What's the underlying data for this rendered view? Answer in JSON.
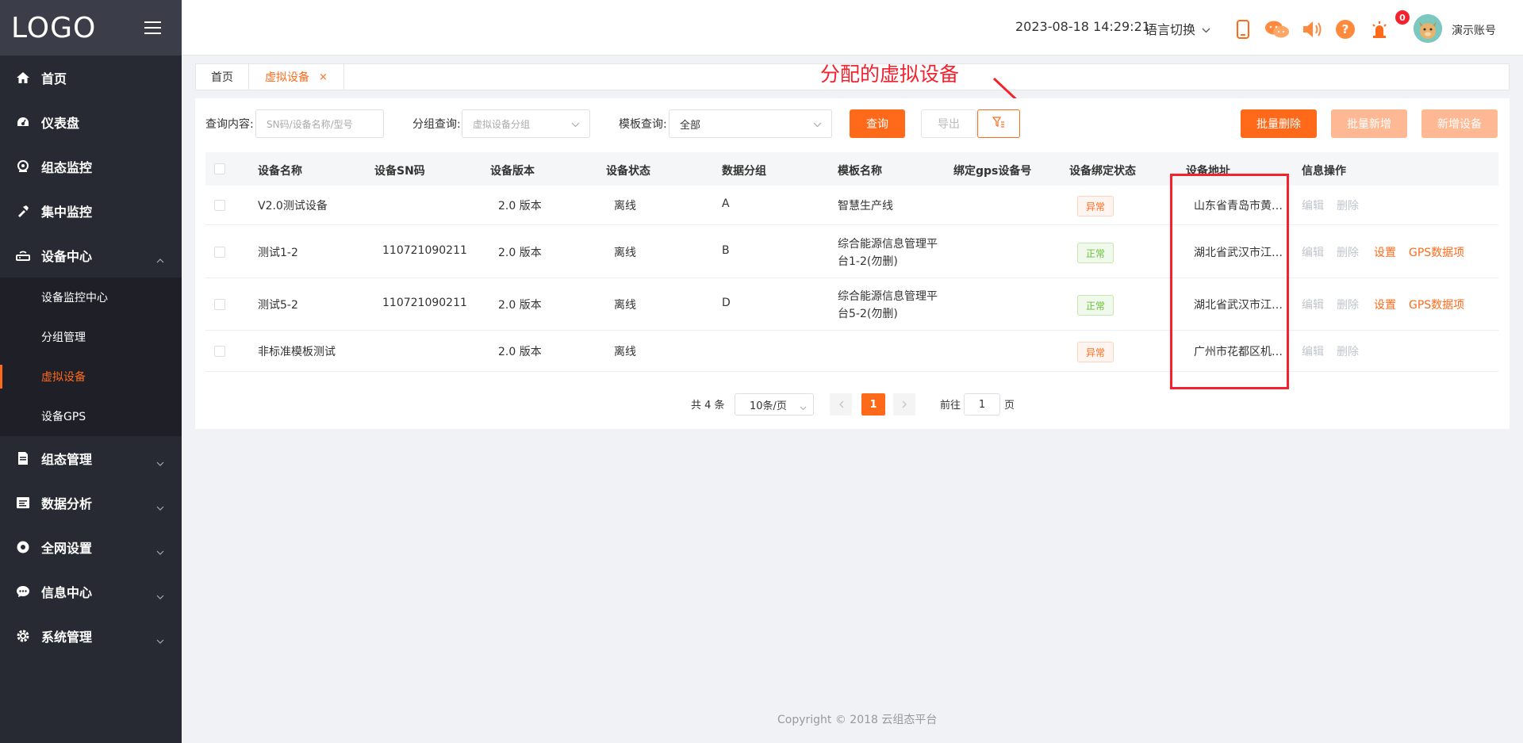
{
  "sidebar": {
    "logo": "LOGO",
    "menu": [
      {
        "label": "首页",
        "icon": "home-icon"
      },
      {
        "label": "仪表盘",
        "icon": "dashboard-icon"
      },
      {
        "label": "组态监控",
        "icon": "monitor-icon"
      },
      {
        "label": "集中监控",
        "icon": "hammer-icon"
      },
      {
        "label": "设备中心",
        "icon": "router-icon"
      }
    ],
    "sub_items": [
      {
        "label": "设备监控中心"
      },
      {
        "label": "分组管理"
      },
      {
        "label": "虚拟设备"
      },
      {
        "label": "设备GPS"
      }
    ],
    "menu_bottom": [
      {
        "label": "组态管理",
        "icon": "document-icon"
      },
      {
        "label": "数据分析",
        "icon": "report-icon"
      },
      {
        "label": "全网设置",
        "icon": "circle-icon"
      },
      {
        "label": "信息中心",
        "icon": "chat-icon"
      },
      {
        "label": "系统管理",
        "icon": "gear-icon"
      }
    ]
  },
  "header": {
    "datetime": "2023-08-18 14:29:21",
    "language": "语言切换",
    "alarm_count": "0",
    "account": "演示账号"
  },
  "tabs": [
    {
      "label": "首页"
    },
    {
      "label": "虚拟设备",
      "close": "×"
    }
  ],
  "filters": {
    "query_label": "查询内容:",
    "query_placeholder": "SN码/设备名称/型号",
    "group_label": "分组查询:",
    "group_placeholder": "虚拟设备分组",
    "template_label": "模板查询:",
    "template_value": "全部",
    "search_btn": "查询",
    "export_btn": "导出"
  },
  "actions": {
    "batch_delete": "批量删除",
    "batch_add": "批量新增",
    "add_device": "新增设备"
  },
  "table": {
    "columns": [
      "设备名称",
      "设备SN码",
      "设备版本",
      "设备状态",
      "数据分组",
      "模板名称",
      "绑定gps设备号",
      "设备绑定状态",
      "设备地址",
      "信息操作"
    ],
    "rows": [
      {
        "name": "V2.0测试设备",
        "sn": "",
        "version": "2.0 版本",
        "status": "离线",
        "group": "A",
        "template": "智慧生产线",
        "template2": "",
        "gps": "",
        "bind": "异常",
        "address": "山东省青岛市黄…",
        "ops": [
          "编辑",
          "删除"
        ]
      },
      {
        "name": "测试1-2",
        "sn": "110721090211",
        "version": "2.0 版本",
        "status": "离线",
        "group": "B",
        "template": "综合能源信息管理平",
        "template2": "台1-2(勿删)",
        "gps": "",
        "bind": "正常",
        "address": "湖北省武汉市江…",
        "ops": [
          "编辑",
          "删除",
          "设置",
          "GPS数据项"
        ]
      },
      {
        "name": "测试5-2",
        "sn": "110721090211",
        "version": "2.0 版本",
        "status": "离线",
        "group": "D",
        "template": "综合能源信息管理平",
        "template2": "台5-2(勿删)",
        "gps": "",
        "bind": "正常",
        "address": "湖北省武汉市江…",
        "ops": [
          "编辑",
          "删除",
          "设置",
          "GPS数据项"
        ]
      },
      {
        "name": "非标准模板测试",
        "sn": "",
        "version": "2.0 版本",
        "status": "离线",
        "group": "",
        "template": "",
        "template2": "",
        "gps": "",
        "bind": "异常",
        "address": "广州市花都区机…",
        "ops": [
          "编辑",
          "删除"
        ]
      }
    ]
  },
  "pagination": {
    "total": "共 4 条",
    "page_size": "10条/页",
    "current": "1",
    "goto_label": "前往",
    "goto_value": "1",
    "page_suffix": "页"
  },
  "annotation": {
    "text": "分配的虚拟设备"
  },
  "footer": {
    "copyright": "Copyright © 2018 云组态平台"
  },
  "colors": {
    "accent": "#ff6a1a",
    "sidebar_bg": "#282a33",
    "annotation": "#f5222d"
  }
}
